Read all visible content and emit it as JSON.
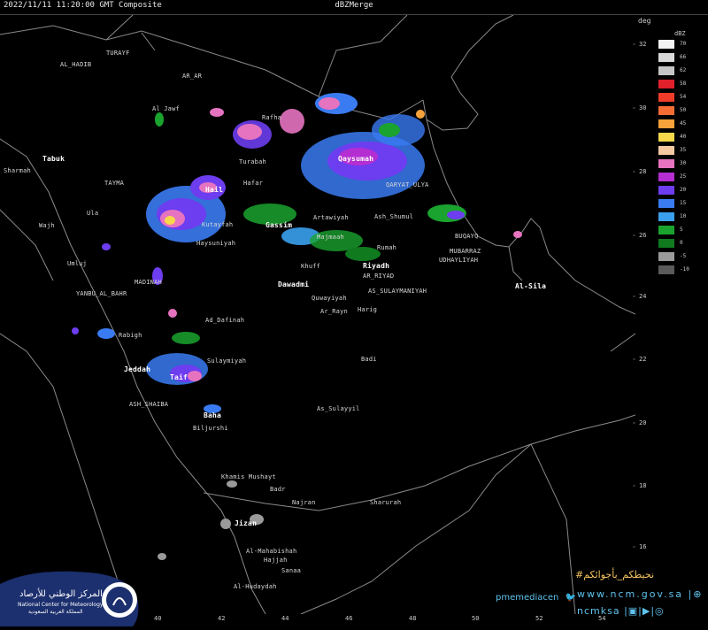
{
  "header": {
    "timestamp": "2022/11/11 11:20:00 GMT Composite",
    "product": "dBZMerge"
  },
  "axis": {
    "lat_unit": "deg",
    "lat_ticks": [
      "32",
      "30",
      "28",
      "26",
      "24",
      "22",
      "20",
      "18",
      "16"
    ],
    "lon_ticks": [
      "40",
      "42",
      "44",
      "46",
      "48",
      "50",
      "52",
      "54"
    ]
  },
  "legend": {
    "title": "dBZ",
    "items": [
      {
        "label": "70",
        "color": "#f2f2f2"
      },
      {
        "label": "66",
        "color": "#d9d9d9"
      },
      {
        "label": "62",
        "color": "#c6c6c6"
      },
      {
        "label": "58",
        "color": "#e0202a"
      },
      {
        "label": "54",
        "color": "#ee3c28"
      },
      {
        "label": "50",
        "color": "#f46d34"
      },
      {
        "label": "45",
        "color": "#f7a23a"
      },
      {
        "label": "40",
        "color": "#f7d84a"
      },
      {
        "label": "35",
        "color": "#f4c8a0"
      },
      {
        "label": "30",
        "color": "#e673c0"
      },
      {
        "label": "25",
        "color": "#b42ed2"
      },
      {
        "label": "20",
        "color": "#6d3df0"
      },
      {
        "label": "15",
        "color": "#3a7bf2"
      },
      {
        "label": "10",
        "color": "#3aa0ee"
      },
      {
        "label": "5",
        "color": "#1aa32e"
      },
      {
        "label": "0",
        "color": "#0f7a1e"
      },
      {
        "label": "-5",
        "color": "#9a9a9a"
      },
      {
        "label": "-10",
        "color": "#5a5a5a"
      }
    ]
  },
  "cities": [
    {
      "name": "TURAYF",
      "major": false
    },
    {
      "name": "AL_HADIB",
      "major": false
    },
    {
      "name": "AR_AR",
      "major": false
    },
    {
      "name": "Rafha",
      "major": false
    },
    {
      "name": "Turabah",
      "major": false
    },
    {
      "name": "Qaysumah",
      "major": true
    },
    {
      "name": "Al Jawf",
      "major": false
    },
    {
      "name": "Hail",
      "major": true
    },
    {
      "name": "Tabuk",
      "major": true
    },
    {
      "name": "TAYMA",
      "major": false
    },
    {
      "name": "Ula",
      "major": false
    },
    {
      "name": "Wajh",
      "major": false
    },
    {
      "name": "Umluj",
      "major": false
    },
    {
      "name": "YANBU_AL_BAHR",
      "major": false
    },
    {
      "name": "MADINAH",
      "major": false
    },
    {
      "name": "Kutayfah",
      "major": false
    },
    {
      "name": "Haysuniyah",
      "major": false
    },
    {
      "name": "Gassim",
      "major": true
    },
    {
      "name": "Artawiyah",
      "major": false
    },
    {
      "name": "Majmaah",
      "major": false
    },
    {
      "name": "Ash_Shumul",
      "major": false
    },
    {
      "name": "QARYAT_ULYA",
      "major": false
    },
    {
      "name": "Rumah",
      "major": false
    },
    {
      "name": "Khuff",
      "major": false
    },
    {
      "name": "Riyadh",
      "major": true
    },
    {
      "name": "AR_RIYAD",
      "major": false
    },
    {
      "name": "Dawadmi",
      "major": true
    },
    {
      "name": "AS_SULAYMANIYAH",
      "major": false
    },
    {
      "name": "Quwayiyah",
      "major": false
    },
    {
      "name": "Ar_Rayn",
      "major": false
    },
    {
      "name": "Harig",
      "major": false
    },
    {
      "name": "Ad_Dafinah",
      "major": false
    },
    {
      "name": "Rabigh",
      "major": false
    },
    {
      "name": "Jeddah",
      "major": true
    },
    {
      "name": "Taif",
      "major": true
    },
    {
      "name": "Sulaymiyah",
      "major": false
    },
    {
      "name": "ASH_SHAIBA",
      "major": false
    },
    {
      "name": "Baha",
      "major": true
    },
    {
      "name": "Biljurshi",
      "major": false
    },
    {
      "name": "Badi",
      "major": false
    },
    {
      "name": "As_Sulayyil",
      "major": false
    },
    {
      "name": "Khamis Mushayt",
      "major": false
    },
    {
      "name": "Badr",
      "major": false
    },
    {
      "name": "Najran",
      "major": false
    },
    {
      "name": "Sharurah",
      "major": false
    },
    {
      "name": "Jizan",
      "major": true
    },
    {
      "name": "Al-Mahabishah",
      "major": false
    },
    {
      "name": "Hajjah",
      "major": false
    },
    {
      "name": "Sanaa",
      "major": false
    },
    {
      "name": "Al-Hudaydah",
      "major": false
    },
    {
      "name": "BUQAYQ",
      "major": false
    },
    {
      "name": "MUBARRAZ",
      "major": false
    },
    {
      "name": "UDHAYLIYAH",
      "major": false
    },
    {
      "name": "Al-Sila",
      "major": true
    },
    {
      "name": "Hafar",
      "major": false
    },
    {
      "name": "Sharmah",
      "major": false
    }
  ],
  "branding": {
    "logo_ar": "المركز الوطني للأرصاد",
    "logo_en": "National Center for Meteorology",
    "logo_ar_sub": "المملكة العربية السعودية",
    "hashtag": "#نحيطكم_بأجوائكم",
    "media_handle": "pmemediacen",
    "website": "www.ncm.gov.sa",
    "social_handle": "ncmksa"
  }
}
